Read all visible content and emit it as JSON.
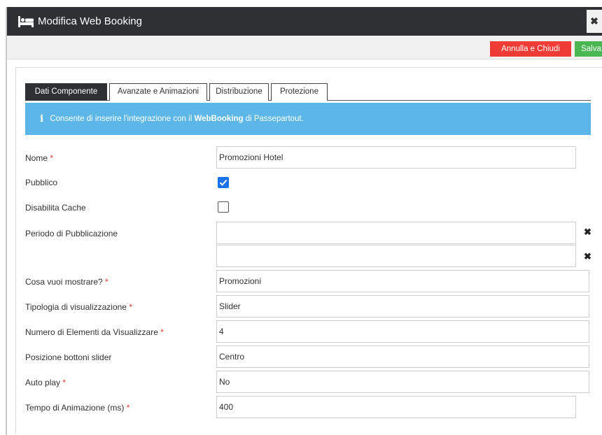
{
  "window": {
    "title": "Modifica Web Booking",
    "icon": "bed-icon",
    "close_label": "✖"
  },
  "toolbar": {
    "cancel_label": "Annulla e Chiudi",
    "save_label": "Salva"
  },
  "tabs": [
    {
      "label": "Dati Componente",
      "active": true
    },
    {
      "label": "Avanzate e Animazioni",
      "active": false
    },
    {
      "label": "Distribuzione",
      "active": false
    },
    {
      "label": "Protezione",
      "active": false
    }
  ],
  "info": {
    "icon": "info-icon",
    "text_pre": "Consente di inserire l'integrazione con il ",
    "text_bold": "WebBooking",
    "text_post": " di Passepartout."
  },
  "form": {
    "nome": {
      "label": "Nome",
      "required": "*",
      "value": "Promozioni Hotel"
    },
    "pubblico": {
      "label": "Pubblico",
      "checked": true
    },
    "disabilita_cache": {
      "label": "Disabilita Cache",
      "checked": false
    },
    "periodo": {
      "label": "Periodo di Pubblicazione",
      "start_value": "",
      "end_value": "",
      "clear_label": "✖"
    },
    "cosa_mostrare": {
      "label": "Cosa vuoi mostrare?",
      "required": "*",
      "value": "Promozioni"
    },
    "tipologia": {
      "label": "Tipologia di visualizzazione",
      "required": "*",
      "value": "Slider"
    },
    "numero_elementi": {
      "label": "Numero di Elementi da Visualizzare",
      "required": "*",
      "value": "4"
    },
    "posizione_bottoni": {
      "label": "Posizione bottoni slider",
      "value": "Centro"
    },
    "auto_play": {
      "label": "Auto play",
      "required": "*",
      "value": "No"
    },
    "tempo_animazione": {
      "label": "Tempo di Animazione (ms)",
      "required": "*",
      "value": "400"
    }
  },
  "colors": {
    "titlebar": "#2f3033",
    "cancel": "#ee3b35",
    "save": "#4bb752",
    "info": "#5cb6e8",
    "checkbox": "#1a73e8",
    "required": "#e53935"
  }
}
